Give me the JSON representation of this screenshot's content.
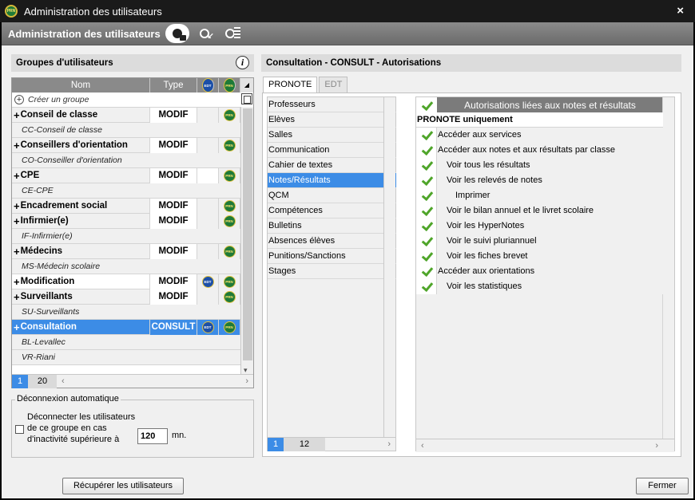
{
  "window": {
    "title": "Administration des utilisateurs",
    "close_glyph": "×",
    "app_badge": "PRN"
  },
  "header": {
    "title": "Administration des utilisateurs",
    "icons": [
      "user-lock-icon",
      "user-import-icon",
      "user-list-icon"
    ]
  },
  "left": {
    "panel_title": "Groupes d'utilisateurs",
    "info_glyph": "i",
    "columns": {
      "nom": "Nom",
      "type": "Type",
      "edt": "EDT",
      "pro": "PRN"
    },
    "create_label": "Créer un groupe",
    "rows": [
      {
        "kind": "group",
        "name": "Conseil de classe",
        "type": "MODIF",
        "edt": false,
        "pro": true
      },
      {
        "kind": "sub",
        "name": "CC-Conseil de classe"
      },
      {
        "kind": "group",
        "name": "Conseillers d'orientation",
        "type": "MODIF",
        "edt": false,
        "pro": true
      },
      {
        "kind": "sub",
        "name": "CO-Conseiller d'orientation"
      },
      {
        "kind": "group",
        "name": "CPE",
        "type": "MODIF",
        "edt": false,
        "pro": true,
        "edt_white": true
      },
      {
        "kind": "sub",
        "name": "CE-CPE"
      },
      {
        "kind": "group",
        "name": "Encadrement social",
        "type": "MODIF",
        "edt": false,
        "pro": true
      },
      {
        "kind": "group",
        "name": "Infirmier(e)",
        "type": "MODIF",
        "edt": false,
        "pro": true
      },
      {
        "kind": "sub",
        "name": "IF-Infirmier(e)"
      },
      {
        "kind": "group",
        "name": "Médecins",
        "type": "MODIF",
        "edt": false,
        "pro": true
      },
      {
        "kind": "sub",
        "name": "MS-Médecin scolaire"
      },
      {
        "kind": "group",
        "name": "Modification",
        "type": "MODIF",
        "edt": true,
        "pro": true,
        "white": true
      },
      {
        "kind": "group",
        "name": "Surveillants",
        "type": "MODIF",
        "edt": false,
        "pro": true
      },
      {
        "kind": "sub",
        "name": "SU-Surveillants"
      },
      {
        "kind": "group",
        "name": "Consultation",
        "type": "CONSULT",
        "edt": true,
        "pro": true,
        "selected": true
      },
      {
        "kind": "sub",
        "name": "BL-Levallec"
      },
      {
        "kind": "sub",
        "name": "VR-Riani"
      }
    ],
    "pager": {
      "current": "1",
      "total": "20"
    },
    "disconnect": {
      "legend": "Déconnexion automatique",
      "text": "Déconnecter les utilisateurs de ce groupe en cas d'inactivité supérieure à",
      "value": "120",
      "unit": "mn.",
      "checked": false
    },
    "recover_button": "Récupérer les utilisateurs"
  },
  "right": {
    "panel_title": "Consultation - CONSULT - Autorisations",
    "tabs": [
      "PRONOTE",
      "EDT"
    ],
    "active_tab": 0,
    "categories": [
      "Professeurs",
      "Elèves",
      "Salles",
      "Communication",
      "Cahier de textes",
      "Notes/Résultats",
      "QCM",
      "Compétences",
      "Bulletins",
      "Absences élèves",
      "Punitions/Sanctions",
      "Stages"
    ],
    "selected_category": 5,
    "cat_pager": {
      "current": "1",
      "total": "12"
    },
    "perm_header": "Autorisations liées aux notes et résultats",
    "permissions": [
      {
        "label": "PRONOTE uniquement",
        "plain": true,
        "indent": 0
      },
      {
        "label": "Accéder aux services",
        "checked": true,
        "indent": 0
      },
      {
        "label": "Accéder aux notes et aux résultats par classe",
        "checked": true,
        "indent": 0
      },
      {
        "label": "Voir tous les résultats",
        "checked": true,
        "indent": 1
      },
      {
        "label": "Voir les relevés de notes",
        "checked": true,
        "indent": 1
      },
      {
        "label": "Imprimer",
        "checked": true,
        "indent": 2
      },
      {
        "label": "Voir le bilan annuel et le livret scolaire",
        "checked": true,
        "indent": 1
      },
      {
        "label": "Voir les HyperNotes",
        "checked": true,
        "indent": 1
      },
      {
        "label": "Voir le suivi pluriannuel",
        "checked": true,
        "indent": 1
      },
      {
        "label": "Voir les fiches brevet",
        "checked": true,
        "indent": 1
      },
      {
        "label": "Accéder aux orientations",
        "checked": true,
        "indent": 0
      },
      {
        "label": "Voir les statistiques",
        "checked": true,
        "indent": 1
      }
    ]
  },
  "close_button": "Fermer"
}
